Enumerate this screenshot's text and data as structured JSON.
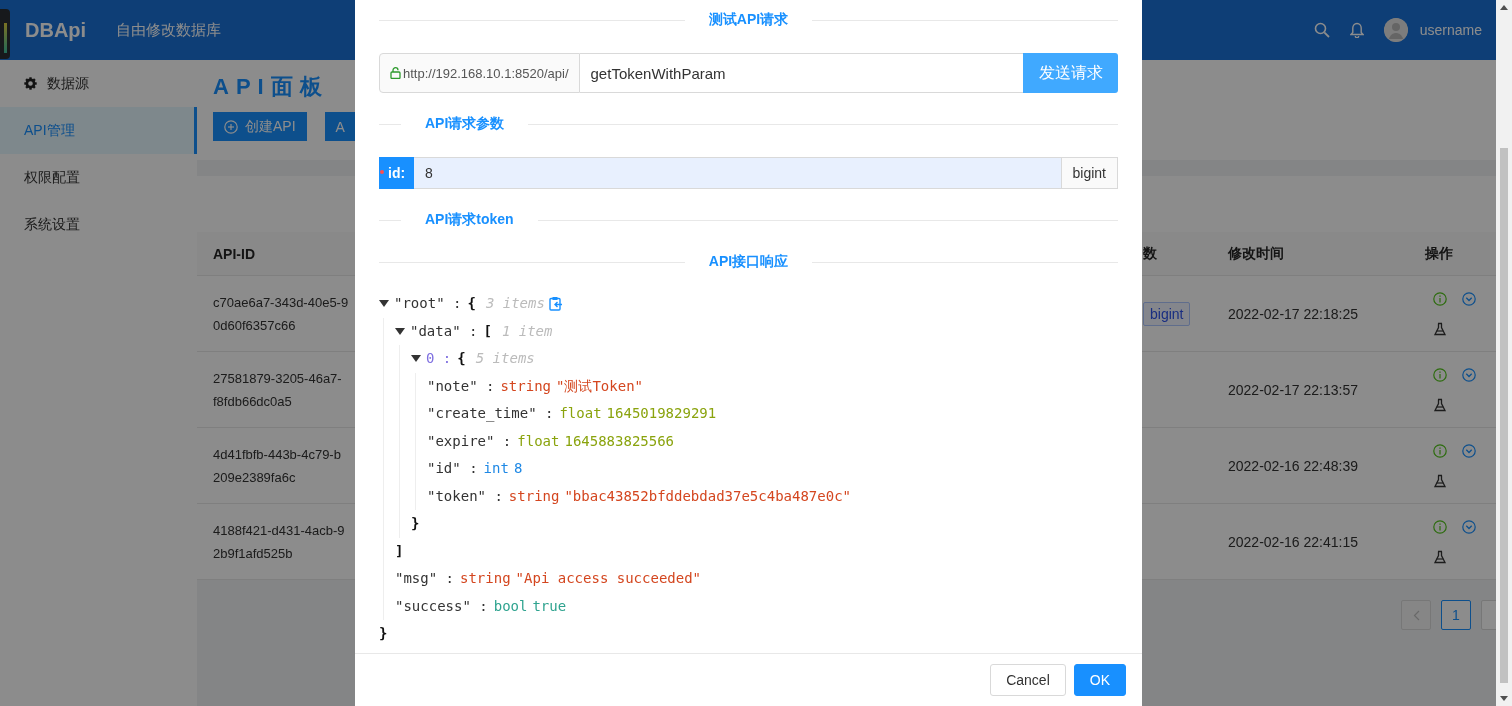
{
  "header": {
    "logo": "DBApi",
    "subtitle": "自由修改数据库",
    "username": "username"
  },
  "sidebar": {
    "items": [
      {
        "label": "数据源",
        "icon": true,
        "selected": false
      },
      {
        "label": "API管理",
        "icon": false,
        "selected": true
      },
      {
        "label": "权限配置",
        "icon": false,
        "selected": false
      },
      {
        "label": "系统设置",
        "icon": false,
        "selected": false
      }
    ]
  },
  "page": {
    "title": "API面板",
    "buttons": [
      {
        "label": "创建API",
        "icon": true
      },
      {
        "label": "A",
        "icon": false
      }
    ]
  },
  "table": {
    "columns": [
      "API-ID",
      "数",
      "修改时间",
      "操作"
    ],
    "rows": [
      {
        "api_id": [
          "c70ae6a7-343d-40e5-9",
          "0d60f6357c66"
        ],
        "param_tag": "bigint",
        "modified": "2022-02-17 22:18:25"
      },
      {
        "api_id": [
          "27581879-3205-46a7-",
          "f8fdb66dc0a5"
        ],
        "modified": "2022-02-17 22:13:57"
      },
      {
        "api_id": [
          "4d41fbfb-443b-4c79-b",
          "209e2389fa6c"
        ],
        "modified": "2022-02-16 22:48:39"
      },
      {
        "api_id": [
          "4188f421-d431-4acb-9",
          "2b9f1afd525b"
        ],
        "modified": "2022-02-16 22:41:15"
      }
    ]
  },
  "pagination": {
    "prev_disabled": true,
    "pages": [
      {
        "label": "1",
        "selected": true
      }
    ]
  },
  "dialog": {
    "sections": [
      {
        "kind": "title",
        "label": "测试API请求"
      },
      {
        "kind": "url",
        "prefix": "http://192.168.10.1:8520/api/",
        "value": "getTokenWithParam",
        "button": "发送请求"
      },
      {
        "kind": "subtitle",
        "label": "API请求参数"
      },
      {
        "kind": "param",
        "name": "id:",
        "required": true,
        "value": "8",
        "type": "bigint"
      },
      {
        "kind": "subtitle",
        "label": "API请求token"
      },
      {
        "kind": "title",
        "label": "API接口响应"
      },
      {
        "kind": "tree",
        "root": {
          "key": "\"root\" :",
          "index": false,
          "open": "{",
          "count": "3 items",
          "copy": true,
          "expanded": true,
          "close": "}",
          "children": [
            {
              "key": "\"data\" :",
              "index": false,
              "open": "[",
              "count": "1 item",
              "copy": false,
              "expanded": true,
              "close": "]",
              "children": [
                {
                  "key": "0 :",
                  "index": true,
                  "open": "{",
                  "count": "5 items",
                  "copy": false,
                  "expanded": true,
                  "close": "}",
                  "children": [
                    {
                      "key": "\"note\" :",
                      "type": "string",
                      "value": "\"测试Token\""
                    },
                    {
                      "key": "\"create_time\" :",
                      "type": "float",
                      "value": "1645019829291"
                    },
                    {
                      "key": "\"expire\" :",
                      "type": "float",
                      "value": "1645883825566"
                    },
                    {
                      "key": "\"id\" :",
                      "type": "int",
                      "value": "8"
                    },
                    {
                      "key": "\"token\" :",
                      "type": "string",
                      "value": "\"bbac43852bfddebdad37e5c4ba487e0c\""
                    }
                  ]
                }
              ]
            },
            {
              "key": "\"msg\" :",
              "type": "string",
              "value": "\"Api access succeeded\""
            },
            {
              "key": "\"success\" :",
              "type": "bool",
              "value": "true"
            }
          ]
        }
      }
    ],
    "buttons": [
      {
        "label": "Cancel",
        "primary": false
      },
      {
        "label": "OK",
        "primary": true
      }
    ]
  }
}
